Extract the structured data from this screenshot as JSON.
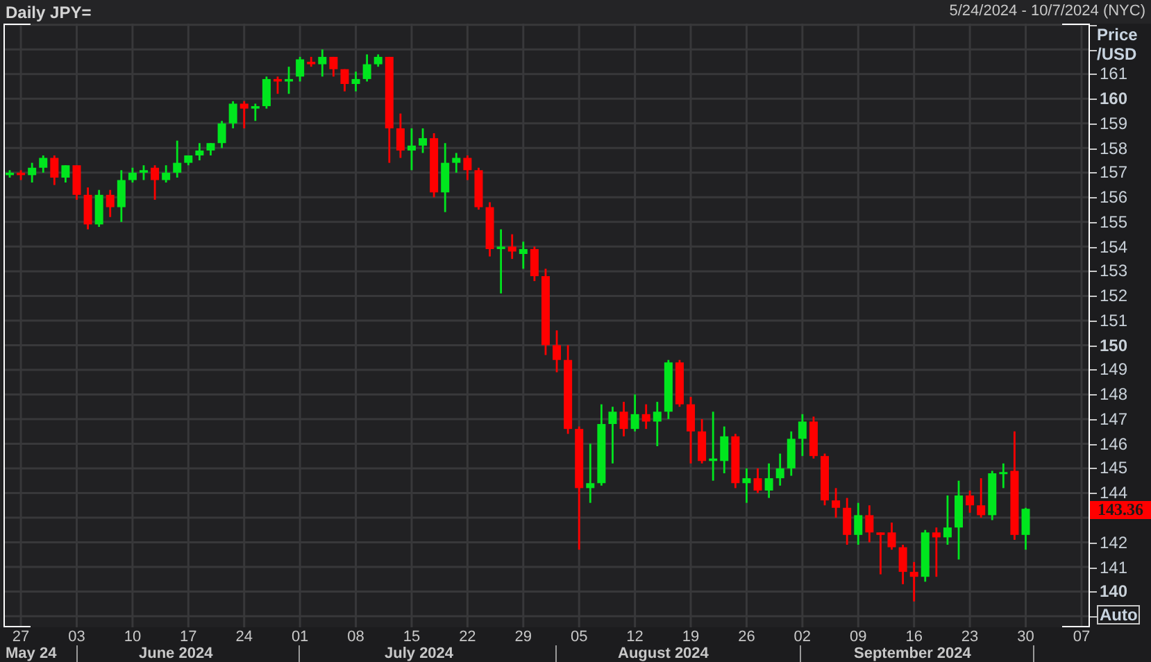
{
  "header": {
    "title": "Daily JPY=",
    "date_range": "5/24/2024 - 10/7/2024 (NYC)"
  },
  "chart_data": {
    "type": "candlestick",
    "ylabel": "Price /USD",
    "ylim": [
      138.55,
      163.05
    ],
    "grid": true,
    "categories": [
      null,
      "27",
      null,
      null,
      null,
      null,
      "03",
      null,
      null,
      null,
      null,
      "10",
      null,
      null,
      null,
      null,
      "17",
      null,
      null,
      null,
      null,
      "24",
      null,
      null,
      null,
      null,
      "01",
      null,
      null,
      null,
      null,
      "08",
      null,
      null,
      null,
      null,
      "15",
      null,
      null,
      null,
      null,
      "22",
      null,
      null,
      null,
      null,
      "29",
      null,
      null,
      null,
      null,
      "05",
      null,
      null,
      null,
      null,
      "12",
      null,
      null,
      null,
      null,
      "19",
      null,
      null,
      null,
      null,
      "26",
      null,
      null,
      null,
      null,
      "02",
      null,
      null,
      null,
      null,
      "09",
      null,
      null,
      null,
      null,
      "16",
      null,
      null,
      null,
      null,
      "23",
      null,
      null,
      null,
      null,
      "30",
      null,
      null,
      null,
      null,
      "07"
    ],
    "yticks": [
      140,
      141,
      142,
      144,
      145,
      146,
      147,
      148,
      149,
      150,
      151,
      152,
      153,
      154,
      155,
      156,
      157,
      158,
      159,
      160,
      161
    ],
    "ohlc": [
      [
        156.9,
        157.1,
        156.8,
        157.0
      ],
      [
        157.0,
        157.1,
        156.7,
        156.9
      ],
      [
        156.9,
        157.4,
        156.6,
        157.2
      ],
      [
        157.2,
        157.7,
        157.0,
        157.6
      ],
      [
        157.6,
        157.7,
        156.5,
        156.8
      ],
      [
        156.8,
        157.3,
        156.6,
        157.3
      ],
      [
        157.3,
        157.3,
        155.9,
        156.1
      ],
      [
        156.1,
        156.4,
        154.7,
        154.9
      ],
      [
        154.9,
        156.3,
        154.8,
        156.1
      ],
      [
        156.1,
        156.3,
        155.2,
        155.6
      ],
      [
        155.6,
        157.1,
        155.0,
        156.7
      ],
      [
        156.7,
        157.2,
        156.6,
        157.0
      ],
      [
        157.0,
        157.3,
        156.7,
        157.1
      ],
      [
        157.2,
        157.3,
        155.9,
        156.7
      ],
      [
        156.7,
        157.3,
        156.6,
        157.0
      ],
      [
        157.0,
        158.3,
        156.8,
        157.4
      ],
      [
        157.4,
        157.7,
        157.3,
        157.7
      ],
      [
        157.7,
        158.2,
        157.5,
        157.9
      ],
      [
        157.9,
        158.2,
        157.7,
        158.2
      ],
      [
        158.2,
        159.1,
        158.0,
        159.0
      ],
      [
        159.0,
        159.9,
        158.8,
        159.8
      ],
      [
        159.8,
        159.9,
        158.8,
        159.6
      ],
      [
        159.6,
        159.8,
        159.1,
        159.7
      ],
      [
        159.7,
        160.9,
        159.6,
        160.8
      ],
      [
        160.8,
        160.9,
        160.2,
        160.7
      ],
      [
        160.7,
        161.3,
        160.2,
        160.8
      ],
      [
        160.9,
        161.7,
        160.7,
        161.6
      ],
      [
        161.5,
        161.7,
        161.3,
        161.4
      ],
      [
        161.4,
        162.0,
        160.9,
        161.7
      ],
      [
        161.7,
        161.7,
        160.9,
        161.2
      ],
      [
        161.2,
        161.2,
        160.3,
        160.6
      ],
      [
        160.6,
        161.1,
        160.3,
        160.8
      ],
      [
        160.8,
        161.8,
        160.7,
        161.4
      ],
      [
        161.4,
        161.8,
        161.3,
        161.7
      ],
      [
        161.7,
        161.7,
        157.4,
        158.8
      ],
      [
        158.8,
        159.4,
        157.6,
        157.9
      ],
      [
        157.9,
        158.8,
        157.1,
        158.1
      ],
      [
        158.1,
        158.8,
        157.8,
        158.4
      ],
      [
        158.4,
        158.6,
        156.0,
        156.2
      ],
      [
        156.2,
        158.2,
        155.4,
        157.4
      ],
      [
        157.4,
        157.8,
        157.0,
        157.6
      ],
      [
        157.6,
        157.7,
        156.7,
        157.1
      ],
      [
        157.1,
        157.2,
        155.5,
        155.6
      ],
      [
        155.6,
        155.8,
        153.6,
        153.9
      ],
      [
        153.9,
        154.7,
        152.1,
        154.0
      ],
      [
        154.0,
        154.5,
        153.5,
        153.8
      ],
      [
        153.7,
        154.2,
        153.1,
        153.9
      ],
      [
        153.9,
        154.0,
        152.6,
        152.8
      ],
      [
        152.8,
        153.1,
        149.6,
        150.0
      ],
      [
        150.0,
        150.6,
        148.9,
        149.4
      ],
      [
        149.4,
        150.0,
        146.4,
        146.6
      ],
      [
        146.6,
        146.7,
        141.7,
        144.2
      ],
      [
        144.2,
        146.0,
        143.6,
        144.4
      ],
      [
        144.4,
        147.6,
        144.3,
        146.8
      ],
      [
        146.8,
        147.5,
        145.2,
        147.3
      ],
      [
        147.3,
        147.7,
        146.3,
        146.6
      ],
      [
        146.6,
        148.0,
        146.5,
        147.2
      ],
      [
        147.2,
        147.6,
        146.6,
        146.9
      ],
      [
        146.9,
        147.7,
        145.9,
        147.3
      ],
      [
        147.3,
        149.4,
        147.0,
        149.3
      ],
      [
        149.3,
        149.4,
        147.5,
        147.6
      ],
      [
        147.6,
        147.9,
        145.2,
        146.5
      ],
      [
        146.5,
        147.0,
        145.2,
        145.3
      ],
      [
        145.3,
        147.3,
        144.5,
        145.4
      ],
      [
        145.3,
        146.7,
        144.8,
        146.3
      ],
      [
        146.3,
        146.4,
        144.2,
        144.4
      ],
      [
        144.4,
        145.0,
        143.6,
        144.6
      ],
      [
        144.6,
        145.0,
        144.0,
        144.1
      ],
      [
        144.1,
        145.2,
        143.8,
        144.6
      ],
      [
        144.6,
        145.6,
        144.3,
        145.0
      ],
      [
        145.0,
        146.5,
        144.7,
        146.2
      ],
      [
        146.2,
        147.2,
        145.5,
        146.9
      ],
      [
        146.9,
        147.1,
        145.4,
        145.5
      ],
      [
        145.5,
        145.6,
        143.5,
        143.7
      ],
      [
        143.7,
        144.2,
        143.0,
        143.4
      ],
      [
        143.4,
        143.8,
        141.9,
        142.3
      ],
      [
        142.3,
        143.6,
        141.9,
        143.1
      ],
      [
        143.1,
        143.5,
        142.0,
        142.4
      ],
      [
        142.4,
        142.4,
        140.7,
        142.3
      ],
      [
        142.4,
        142.8,
        141.7,
        141.8
      ],
      [
        141.8,
        141.9,
        140.3,
        140.8
      ],
      [
        140.8,
        141.2,
        139.6,
        140.6
      ],
      [
        140.6,
        142.5,
        140.4,
        142.4
      ],
      [
        142.4,
        142.6,
        140.6,
        142.2
      ],
      [
        142.2,
        143.9,
        141.9,
        142.6
      ],
      [
        142.6,
        144.5,
        141.3,
        143.9
      ],
      [
        143.9,
        144.1,
        143.2,
        143.5
      ],
      [
        143.5,
        144.6,
        143.0,
        143.1
      ],
      [
        143.1,
        144.9,
        142.9,
        144.8
      ],
      [
        144.8,
        145.2,
        144.2,
        144.85
      ],
      [
        144.9,
        146.5,
        142.1,
        142.3
      ],
      [
        142.3,
        143.4,
        141.7,
        143.36
      ],
      null,
      null,
      null,
      null,
      null
    ]
  },
  "last_price": "143.36",
  "auto_button": "Auto",
  "month_labels": [
    "May 24",
    "June 2024",
    "July 2024",
    "August 2024",
    "September 2024"
  ]
}
